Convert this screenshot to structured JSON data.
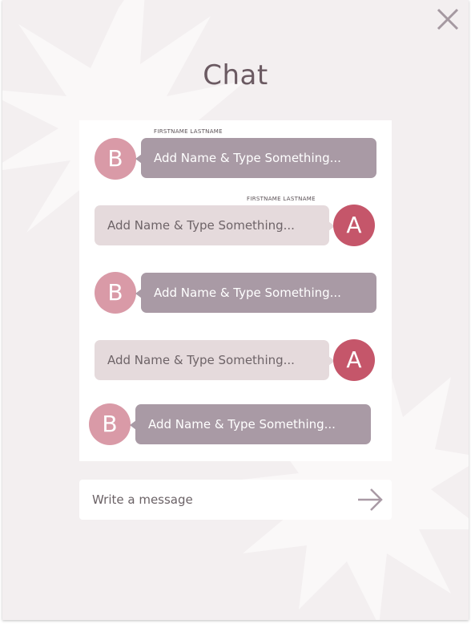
{
  "window": {
    "title": "Chat"
  },
  "messages": [
    {
      "sender": "B",
      "name_label": "FIRSTNAME LASTNAME",
      "text": "Add Name & Type Something..."
    },
    {
      "sender": "A",
      "name_label": "FIRSTNAME LASTNAME",
      "text": "Add Name & Type Something..."
    },
    {
      "sender": "B",
      "name_label": "",
      "text": "Add Name & Type Something..."
    },
    {
      "sender": "A",
      "name_label": "",
      "text": "Add Name & Type Something..."
    },
    {
      "sender": "B",
      "name_label": "",
      "text": "Add Name & Type Something..."
    }
  ],
  "composer": {
    "placeholder": "Write a message"
  },
  "icons": {
    "close": "close-icon",
    "send": "arrow-right-icon"
  },
  "colors": {
    "background": "#f3eff0",
    "bubble_b": "#a99aa5",
    "bubble_a": "#e5dadc",
    "avatar_b": "#d99aa7",
    "avatar_a": "#c5566a",
    "accent": "#a99aa5"
  }
}
